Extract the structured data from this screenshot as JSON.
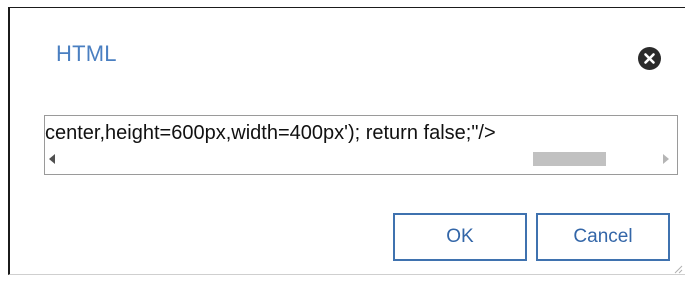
{
  "dialog": {
    "title": "HTML",
    "close_icon": "close-circle-icon",
    "code_value": "center,height=600px,width=400px'); return false;\"/>",
    "scrollbar": {
      "left_arrow_icon": "arrow-left-icon",
      "right_arrow_icon": "arrow-right-icon"
    },
    "buttons": {
      "ok_label": "OK",
      "cancel_label": "Cancel"
    },
    "resize_icon": "resize-grip-icon"
  },
  "colors": {
    "title": "#4a7fc1",
    "button_border": "#3f72af",
    "button_text": "#3366a8",
    "close_bg": "#2b2b2b"
  }
}
